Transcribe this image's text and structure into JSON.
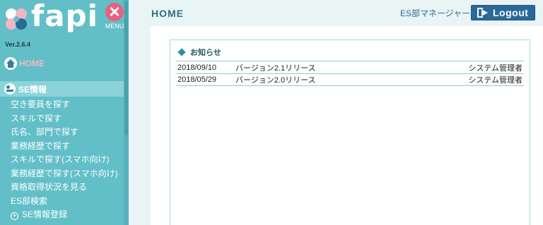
{
  "brand": {
    "name": "fapi",
    "version": "Ver.2.6.4",
    "menu_label": "MENU"
  },
  "sidebar": {
    "home_label": "HOME",
    "section_label": "SE情報",
    "items": [
      {
        "label": "空き要員を探す"
      },
      {
        "label": "スキルで探す"
      },
      {
        "label": "氏名、部門で探す"
      },
      {
        "label": "業務経歴で探す"
      },
      {
        "label": "スキルで探す(スマホ向け)"
      },
      {
        "label": "業務経歴で探す(スマホ向け)"
      },
      {
        "label": "資格取得状況を見る"
      },
      {
        "label": "ES部検索"
      },
      {
        "label": "SE情報登録"
      }
    ]
  },
  "header": {
    "title": "HOME",
    "user": "ES部マネージャー",
    "logout_label": "Logout"
  },
  "news": {
    "heading": "お知らせ",
    "rows": [
      {
        "date": "2018/09/10",
        "title": "バージョン2.1リリース",
        "author": "システム管理者"
      },
      {
        "date": "2018/05/29",
        "title": "バージョン2.0リリース",
        "author": "システム管理者"
      }
    ]
  },
  "colors": {
    "sidebar_bg": "#62bfc8",
    "section_bg": "#8bd3d9",
    "accent_pink": "#e9607e",
    "logout_bg": "#2a6a99"
  }
}
